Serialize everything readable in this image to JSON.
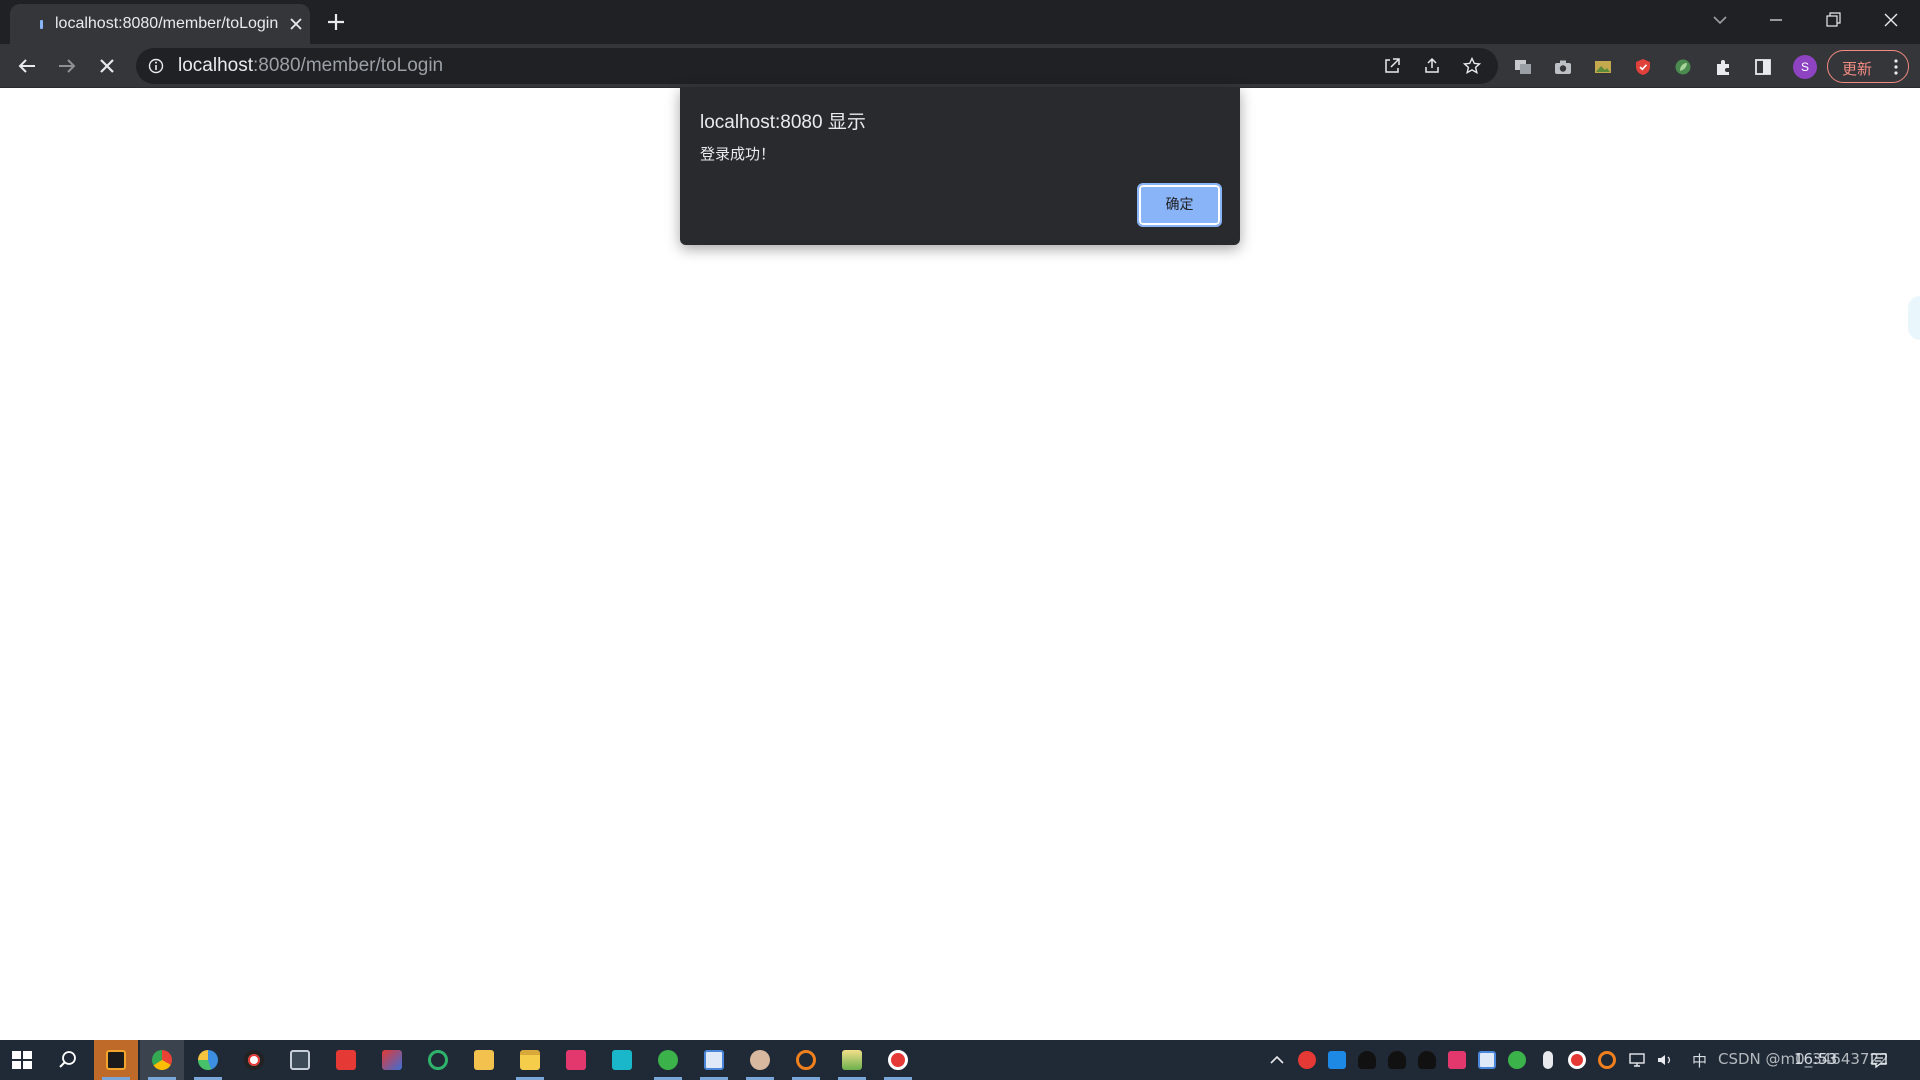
{
  "browser": {
    "tab": {
      "title": "localhost:8080/member/toLogin"
    },
    "address": {
      "host": "localhost",
      "rest": ":8080/member/toLogin"
    },
    "profile_initial": "S",
    "update_label": "更新",
    "colors": {
      "frame": "#202124",
      "toolbar": "#35363a",
      "accent": "#8ab4f8",
      "update": "#f28b82"
    }
  },
  "dialog": {
    "title": "localhost:8080 显示",
    "message": "登录成功！",
    "ok_label": "确定"
  },
  "taskbar": {
    "pinned_icons": [
      "start-icon",
      "search-icon",
      "intellij-icon",
      "chrome-icon",
      "edge-icon",
      "recorder-icon",
      "terminal-icon",
      "news-icon",
      "media-icon",
      "sync-icon",
      "folder-icon",
      "explorer-icon",
      "app-icon",
      "notes-icon",
      "wechat-icon",
      "baidu-netdisk-icon",
      "avatar-app-icon",
      "search-tool-icon",
      "image-tool-icon",
      "record-icon"
    ],
    "tray_icons": [
      "chevron-up-icon",
      "cloud-icon",
      "app-icon",
      "qq-icon",
      "qq-icon",
      "qq-icon",
      "app-icon",
      "netdisk-icon",
      "wechat-icon",
      "mic-icon",
      "record-icon",
      "search-icon",
      "network-icon",
      "volume-icon"
    ],
    "tray_overlay": "CSDN @m0_34643722",
    "clock": "16:53",
    "ime": "中"
  }
}
